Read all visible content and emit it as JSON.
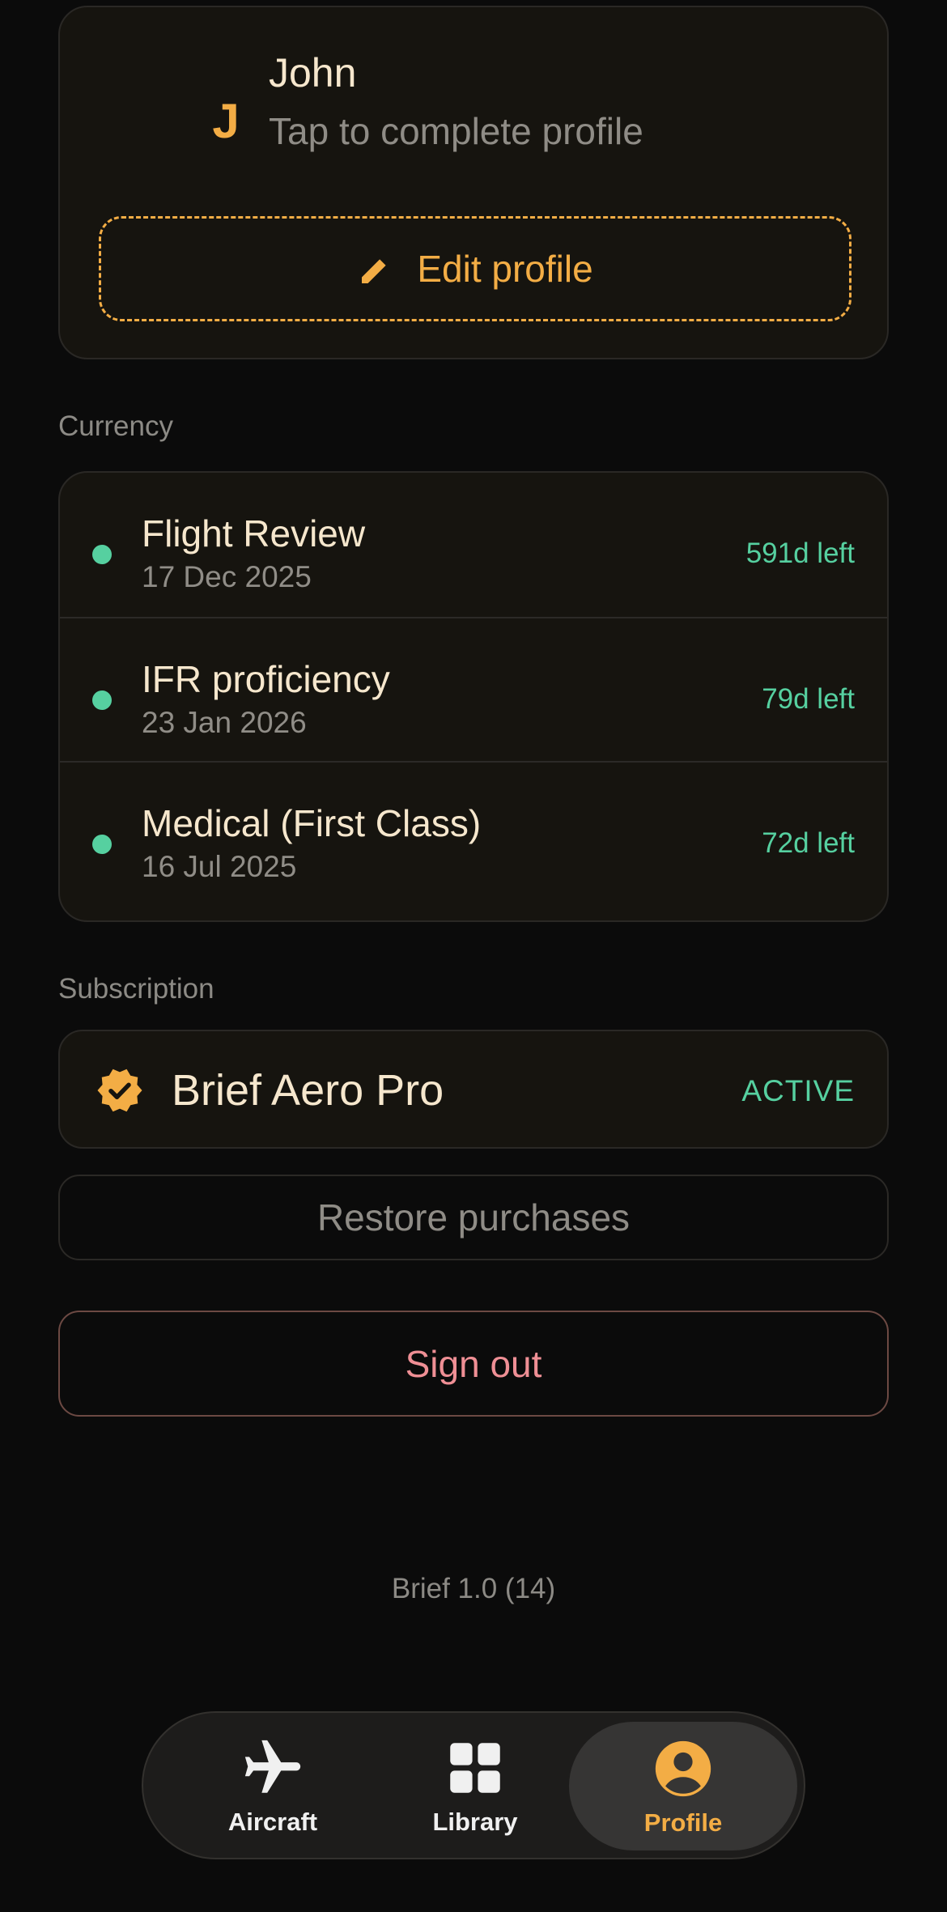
{
  "profile": {
    "initial": "J",
    "name": "John",
    "subtitle": "Tap to complete profile",
    "edit_label": "Edit profile"
  },
  "currency": {
    "section_label": "Currency",
    "items": [
      {
        "title": "Flight Review",
        "date": "17 Dec 2025",
        "remaining": "591d left",
        "status_color": "#56d0a0"
      },
      {
        "title": "IFR proficiency",
        "date": "23 Jan 2026",
        "remaining": "79d left",
        "status_color": "#56d0a0"
      },
      {
        "title": "Medical (First Class)",
        "date": "16 Jul 2025",
        "remaining": "72d left",
        "status_color": "#56d0a0"
      }
    ]
  },
  "subscription": {
    "section_label": "Subscription",
    "plan": "Brief Aero Pro",
    "status": "ACTIVE",
    "badge_icon": "verified-badge-icon",
    "restore_label": "Restore purchases"
  },
  "signout_label": "Sign out",
  "version": "Brief 1.0 (14)",
  "tabbar": {
    "tabs": [
      {
        "label": "Aircraft",
        "icon": "airplane-icon"
      },
      {
        "label": "Library",
        "icon": "grid-icon"
      },
      {
        "label": "Profile",
        "icon": "account-circle-icon",
        "selected": true
      }
    ]
  },
  "colors": {
    "accent": "#f3ad45",
    "positive": "#56d0a0",
    "danger": "#ef8f95",
    "background": "#0b0b0b",
    "card": "#16140f"
  }
}
